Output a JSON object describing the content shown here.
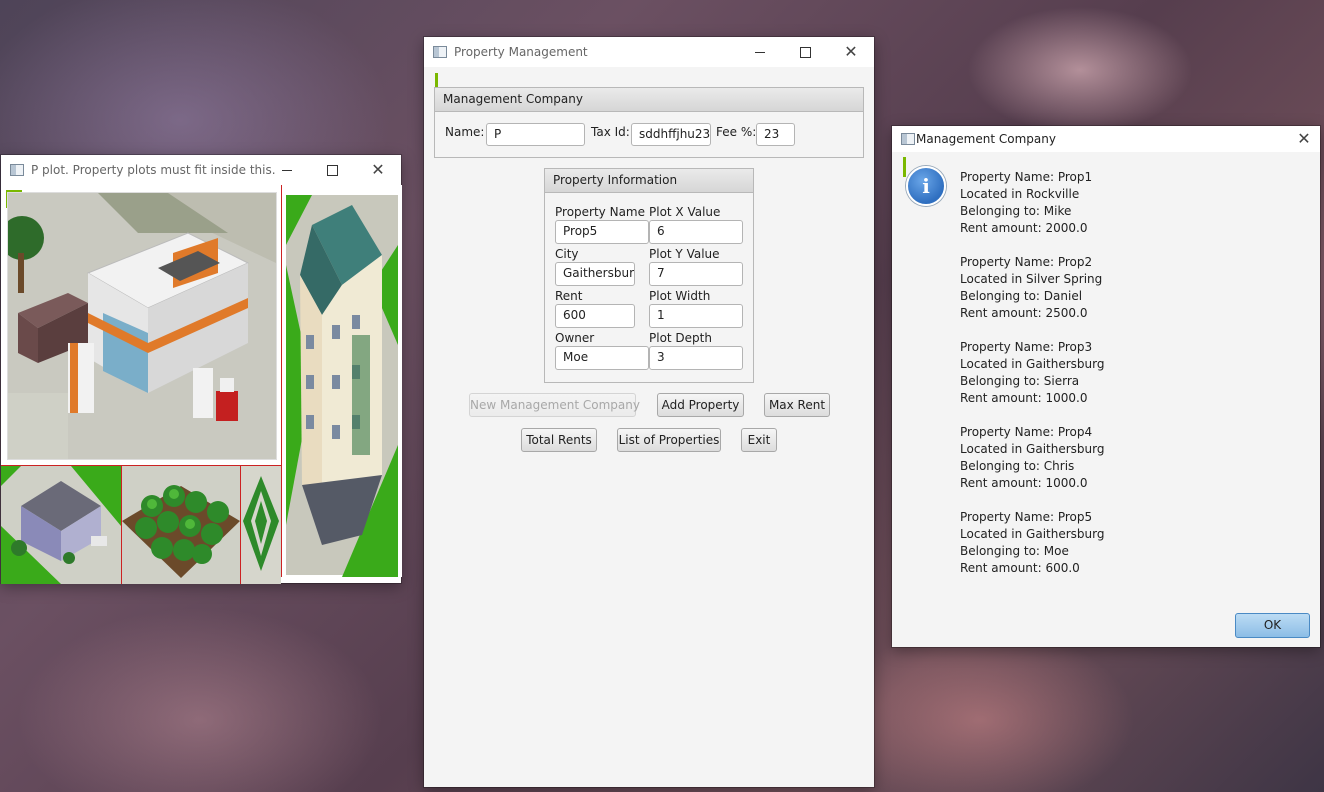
{
  "plot_window": {
    "title": "P plot. Property plots must fit inside this."
  },
  "main_window": {
    "title": "Property Management",
    "company_pane": {
      "header": "Management Company",
      "name_label": "Name:",
      "name_value": "P",
      "taxid_label": "Tax Id:",
      "taxid_value": "sddhffjhu23",
      "fee_label": "Fee %:",
      "fee_value": "23"
    },
    "property_pane": {
      "header": "Property Information",
      "property_name_label": "Property Name",
      "property_name_value": "Prop5",
      "city_label": "City",
      "city_value": "Gaithersburg",
      "rent_label": "Rent",
      "rent_value": "600",
      "owner_label": "Owner",
      "owner_value": "Moe",
      "plot_x_label": "Plot X Value",
      "plot_x_value": "6",
      "plot_y_label": "Plot Y Value",
      "plot_y_value": "7",
      "plot_width_label": "Plot Width",
      "plot_width_value": "1",
      "plot_depth_label": "Plot Depth",
      "plot_depth_value": "3"
    },
    "buttons": {
      "new_company": "New Management Company",
      "add_property": "Add Property",
      "max_rent": "Max Rent",
      "total_rents": "Total Rents",
      "list_properties": "List of Properties",
      "exit": "Exit"
    }
  },
  "dialog": {
    "title": "Management Company",
    "icon_glyph": "i",
    "properties": [
      {
        "name": "Property Name: Prop1",
        "city": "Located in Rockville",
        "owner": "Belonging to: Mike",
        "rent": "Rent amount: 2000.0"
      },
      {
        "name": "Property Name: Prop2",
        "city": "Located in Silver Spring",
        "owner": "Belonging to: Daniel",
        "rent": "Rent amount: 2500.0"
      },
      {
        "name": "Property Name: Prop3",
        "city": "Located in Gaithersburg",
        "owner": "Belonging to: Sierra",
        "rent": "Rent amount: 1000.0"
      },
      {
        "name": "Property Name: Prop4",
        "city": "Located in Gaithersburg",
        "owner": "Belonging to: Chris",
        "rent": "Rent amount: 1000.0"
      },
      {
        "name": "Property Name: Prop5",
        "city": "Located in Gaithersburg",
        "owner": "Belonging to: Moe",
        "rent": "Rent amount: 600.0"
      }
    ],
    "ok_label": "OK"
  },
  "colors": {
    "focus_accent": "#7ab800",
    "plot_border": "#cc2222",
    "info_icon": "#2f6fc0"
  }
}
